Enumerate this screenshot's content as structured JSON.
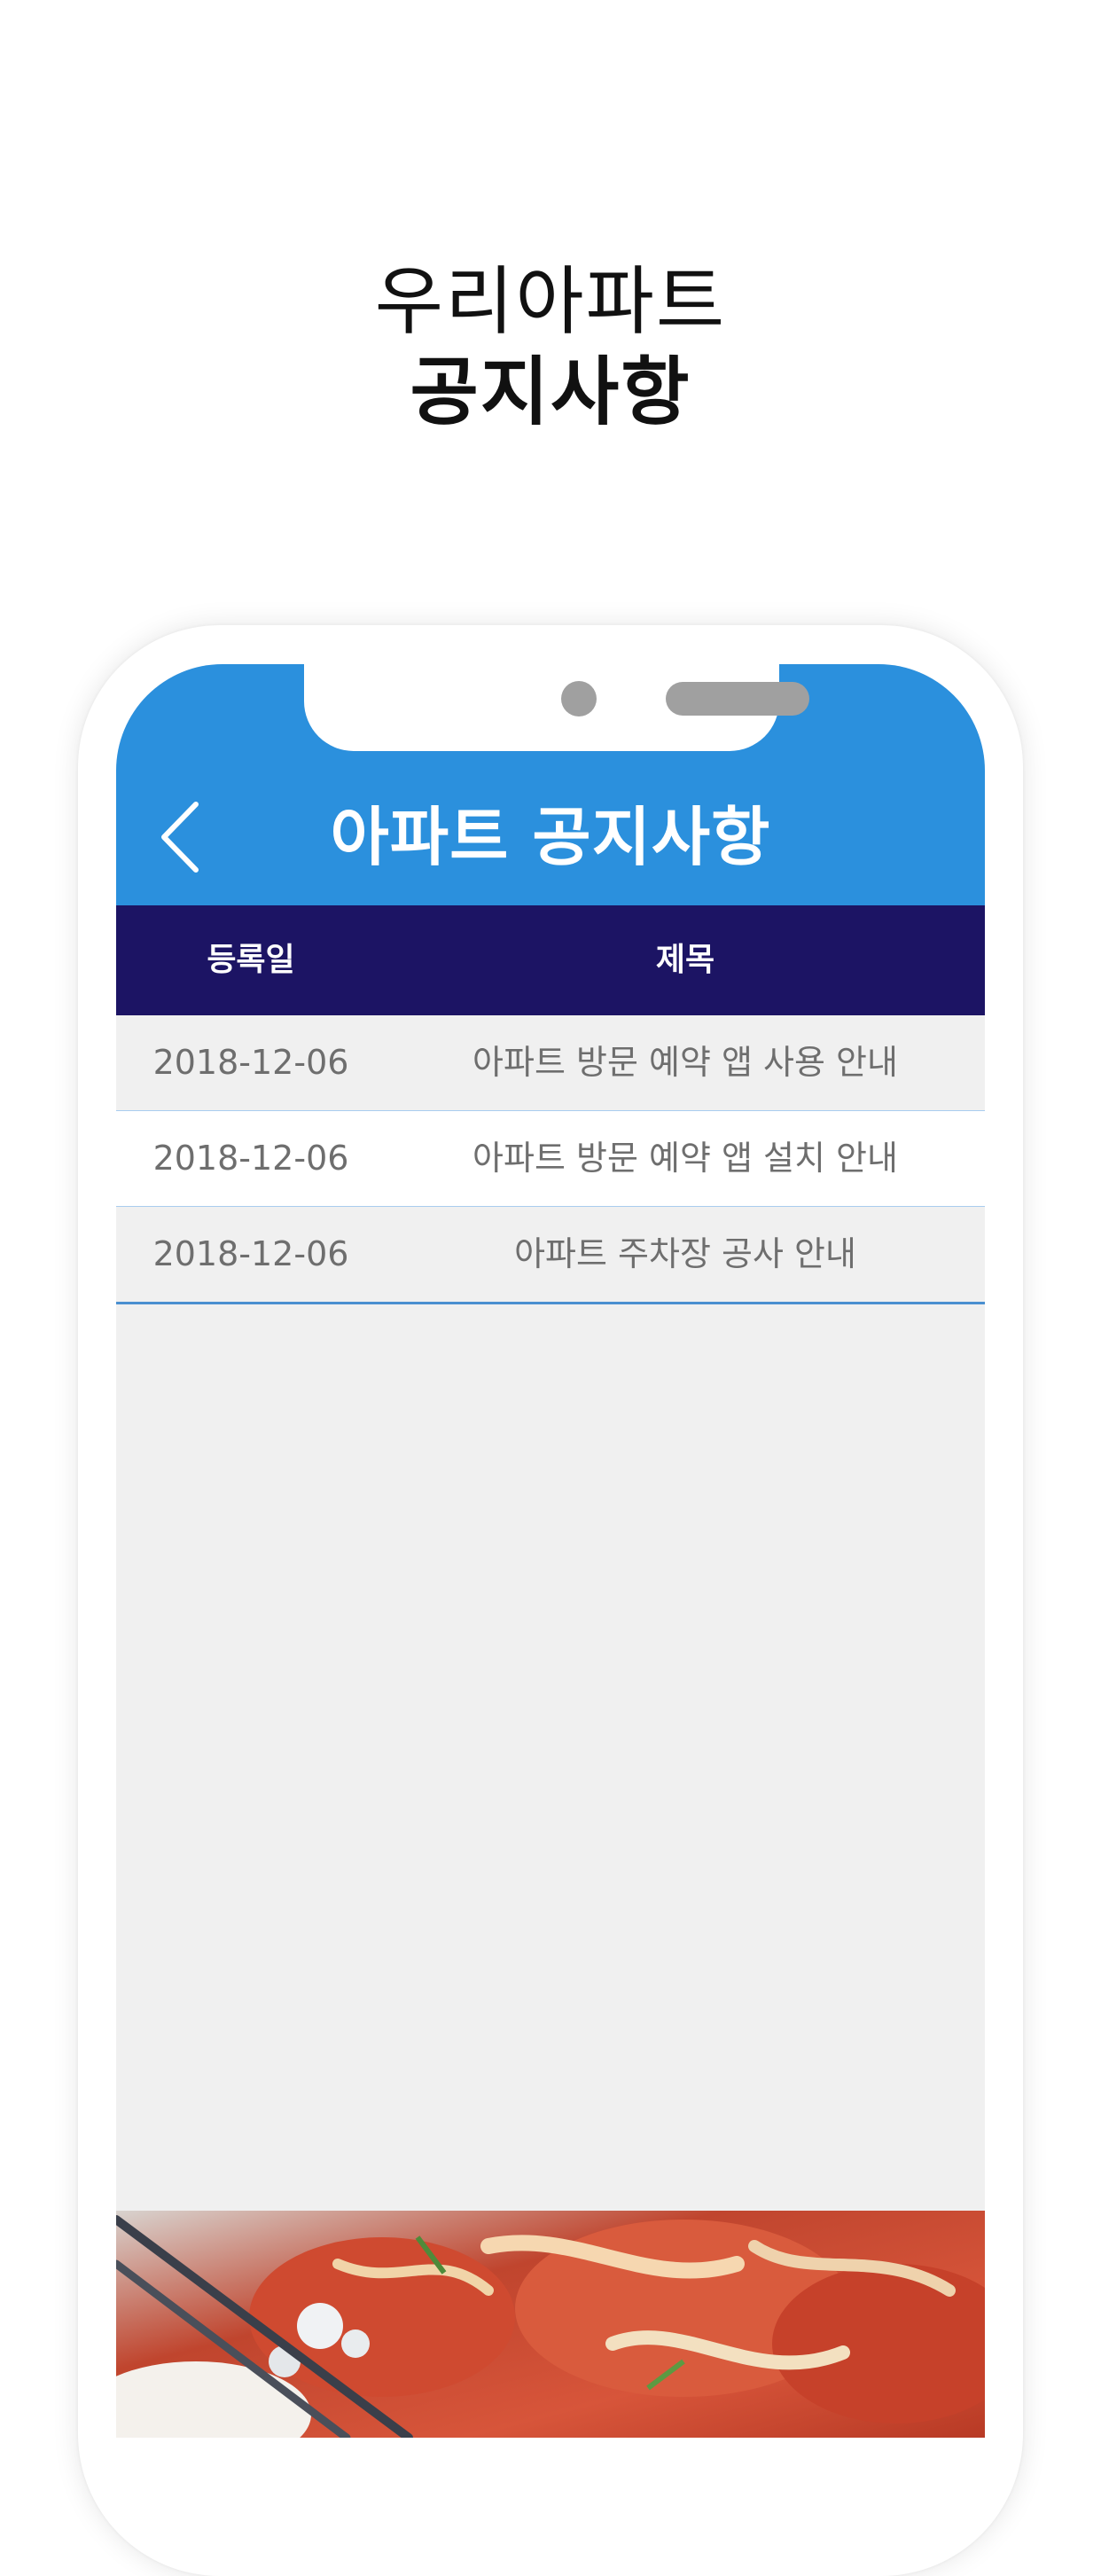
{
  "promo": {
    "line1": "우리아파트",
    "line2": "공지사항"
  },
  "app": {
    "title": "아파트 공지사항",
    "back_icon": "chevron-left-icon",
    "header_color": "#2b90dd",
    "table_head_color": "#1c1464"
  },
  "table": {
    "headers": {
      "date": "등록일",
      "title": "제목"
    },
    "rows": [
      {
        "date": "2018-12-06",
        "title": "아파트 방문 예약 앱 사용 안내"
      },
      {
        "date": "2018-12-06",
        "title": "아파트 방문 예약 앱 설치 안내"
      },
      {
        "date": "2018-12-06",
        "title": "아파트 주차장 공사 안내"
      }
    ]
  }
}
